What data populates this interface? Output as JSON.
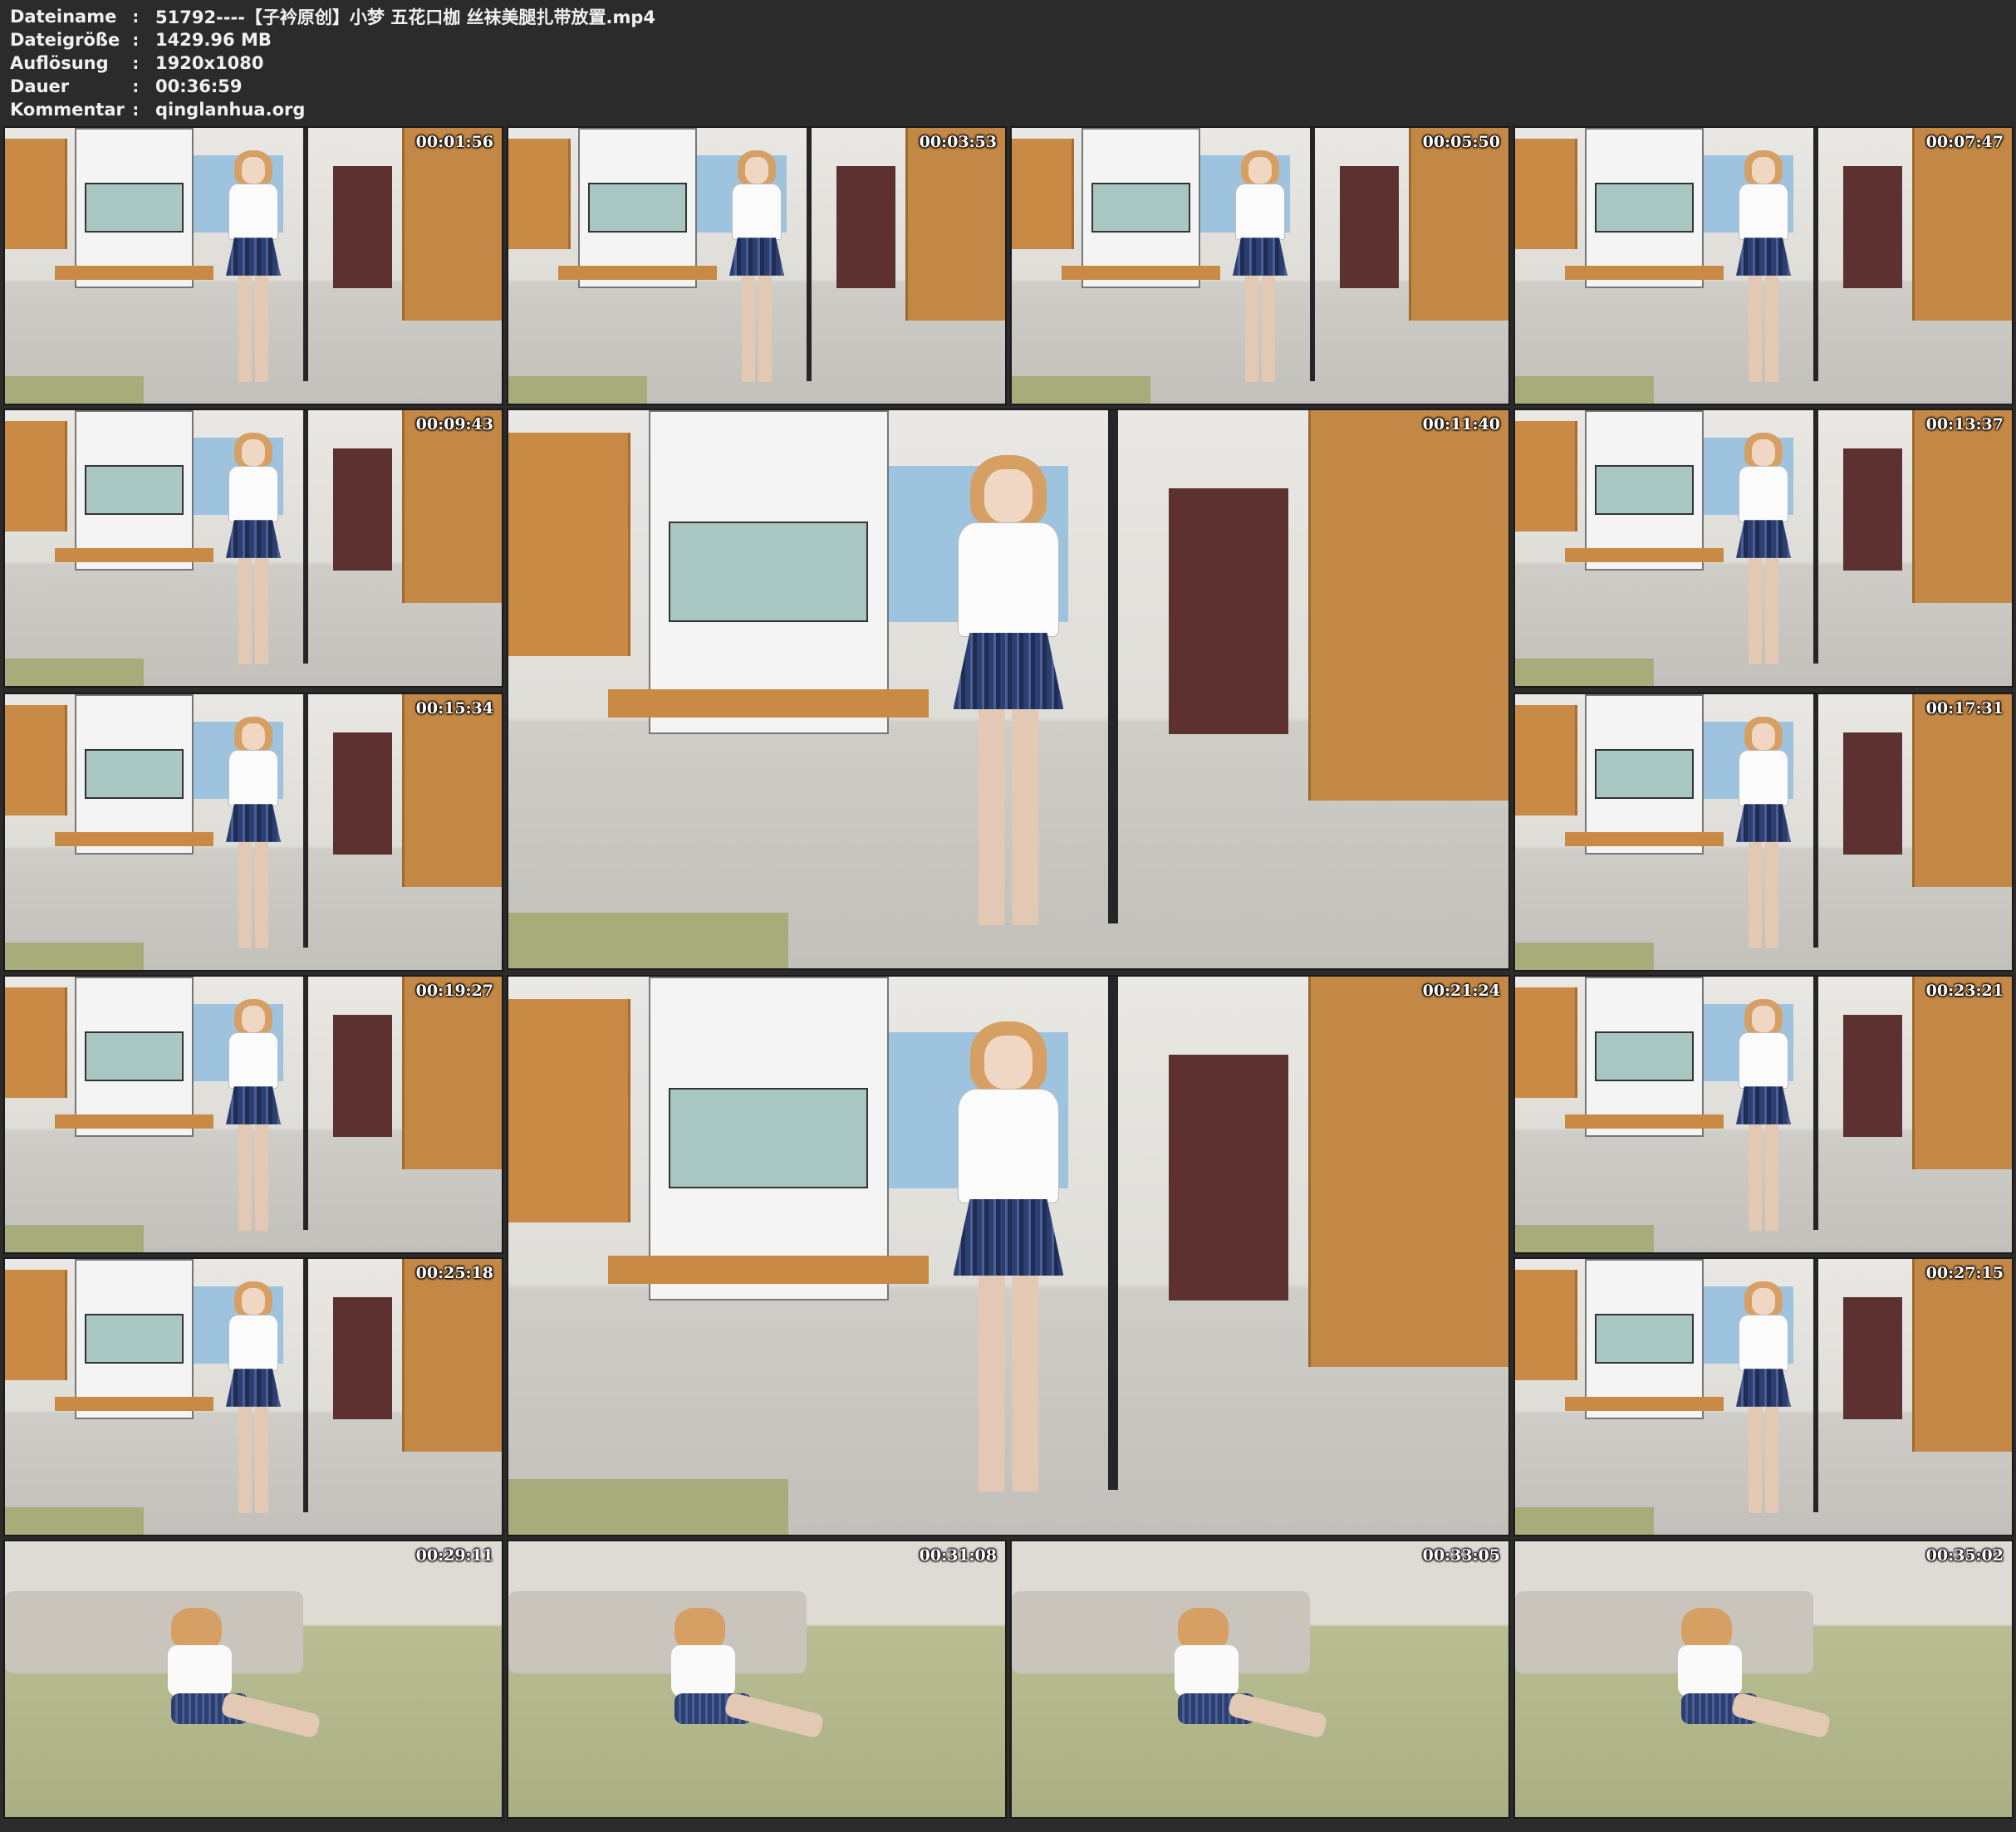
{
  "header": {
    "rows": [
      {
        "key": "Dateiname",
        "sep": ":",
        "value": "51792----【子衿原创】小梦 五花口枷 丝袜美腿扎带放置.mp4"
      },
      {
        "key": "Dateigröße",
        "sep": ":",
        "value": "1429.96 MB"
      },
      {
        "key": "Auflösung",
        "sep": ":",
        "value": "1920x1080"
      },
      {
        "key": "Dauer",
        "sep": ":",
        "value": "00:36:59"
      },
      {
        "key": "Kommentar",
        "sep": ":",
        "value": "qinglanhua.org"
      }
    ]
  },
  "thumbnails": [
    {
      "time": "00:01:56",
      "scene": "standing"
    },
    {
      "time": "00:03:53",
      "scene": "standing"
    },
    {
      "time": "00:05:50",
      "scene": "standing"
    },
    {
      "time": "00:07:47",
      "scene": "standing"
    },
    {
      "time": "00:09:43",
      "scene": "standing"
    },
    {
      "time": "00:11:40",
      "scene": "standing"
    },
    {
      "time": "00:13:37",
      "scene": "standing"
    },
    {
      "time": "00:15:34",
      "scene": "standing"
    },
    {
      "time": "00:17:31",
      "scene": "standing"
    },
    {
      "time": "00:19:27",
      "scene": "standing"
    },
    {
      "time": "00:21:24",
      "scene": "standing"
    },
    {
      "time": "00:23:21",
      "scene": "standing"
    },
    {
      "time": "00:25:18",
      "scene": "standing"
    },
    {
      "time": "00:27:15",
      "scene": "standing"
    },
    {
      "time": "00:29:11",
      "scene": "floor"
    },
    {
      "time": "00:31:08",
      "scene": "floor"
    },
    {
      "time": "00:33:05",
      "scene": "floor"
    },
    {
      "time": "00:35:02",
      "scene": "floor"
    }
  ]
}
